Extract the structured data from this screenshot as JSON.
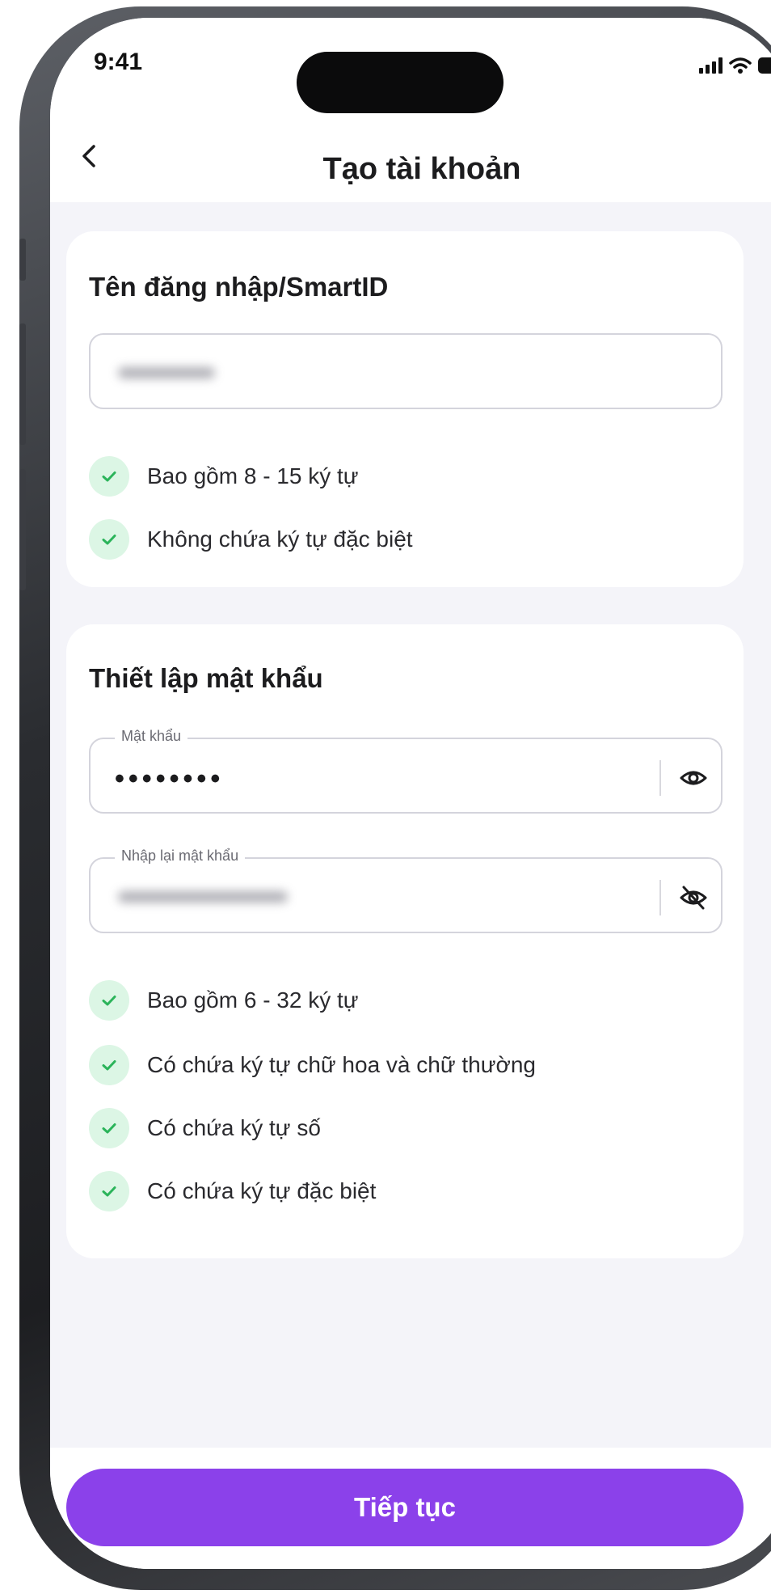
{
  "status_bar": {
    "time": "9:41"
  },
  "nav": {
    "title": "Tạo tài khoản"
  },
  "username_section": {
    "title": "Tên đăng nhập/SmartID",
    "rules": [
      "Bao gồm 8 - 15 ký tự",
      "Không chứa ký tự đặc biệt"
    ]
  },
  "password_section": {
    "title": "Thiết lập mật khẩu",
    "password_label": "Mật khẩu",
    "password_value": "••••••••",
    "confirm_label": "Nhập lại mật khẩu",
    "rules": [
      "Bao gồm 6 - 32 ký tự",
      "Có chứa ký tự chữ hoa và chữ thường",
      "Có chứa ký tự số",
      "Có chứa ký tự đặc biệt"
    ]
  },
  "continue_button": {
    "label": "Tiếp tục"
  },
  "icons": {
    "back": "chevron-left-icon",
    "show_password": "eye-icon",
    "hide_password": "eye-off-icon",
    "check": "check-icon"
  },
  "colors": {
    "accent": "#8b41ea",
    "check_bg": "#dcf6e5",
    "check": "#2bb45a",
    "background": "#f4f4f9"
  }
}
